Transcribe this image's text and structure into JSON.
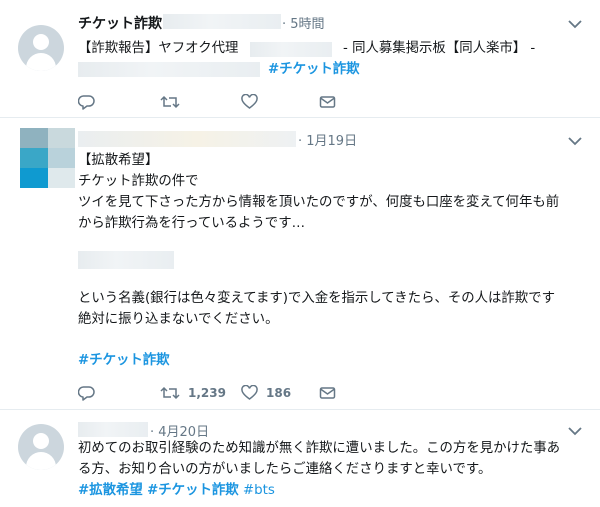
{
  "tweets": [
    {
      "author": "チケット詐欺",
      "time": "5時間",
      "line1": "【詐欺報告】ヤフオク代理",
      "line1_mid": "- 同人募集掲示板【同人楽市】 -",
      "hashtag": "#チケット詐欺"
    },
    {
      "time": "1月19日",
      "lines": [
        "【拡散希望】",
        "チケット詐欺の件で",
        "ツイを見て下さった方から情報を頂いたのですが、何度も口座を変えて何年も前",
        "から詐欺行為を行っているようです…"
      ],
      "lines2": [
        "という名義(銀行は色々変えてます)で入金を指示してきたら、その人は詐欺です",
        "絶対に振り込まないでください。"
      ],
      "hashtag": "#チケット詐欺",
      "retweets": "1,239",
      "likes": "186"
    },
    {
      "time": "4月20日",
      "lines": [
        "初めてのお取引経験のため知識が無く詐欺に遭いました。この方を見かけた事あ",
        "る方、お知り合いの方がいましたらご連絡くださりますと幸いです。"
      ],
      "hashtags": [
        "#拡散希望",
        "#チケット詐欺",
        "#bts"
      ]
    }
  ],
  "icons": {
    "reply": "reply-icon",
    "retweet": "retweet-icon",
    "like": "heart-icon",
    "dm": "envelope-icon",
    "menu": "chevron-down-icon"
  },
  "colors": {
    "link": "#1b95e0",
    "muted": "#657786",
    "divider": "#e6ecf0"
  }
}
